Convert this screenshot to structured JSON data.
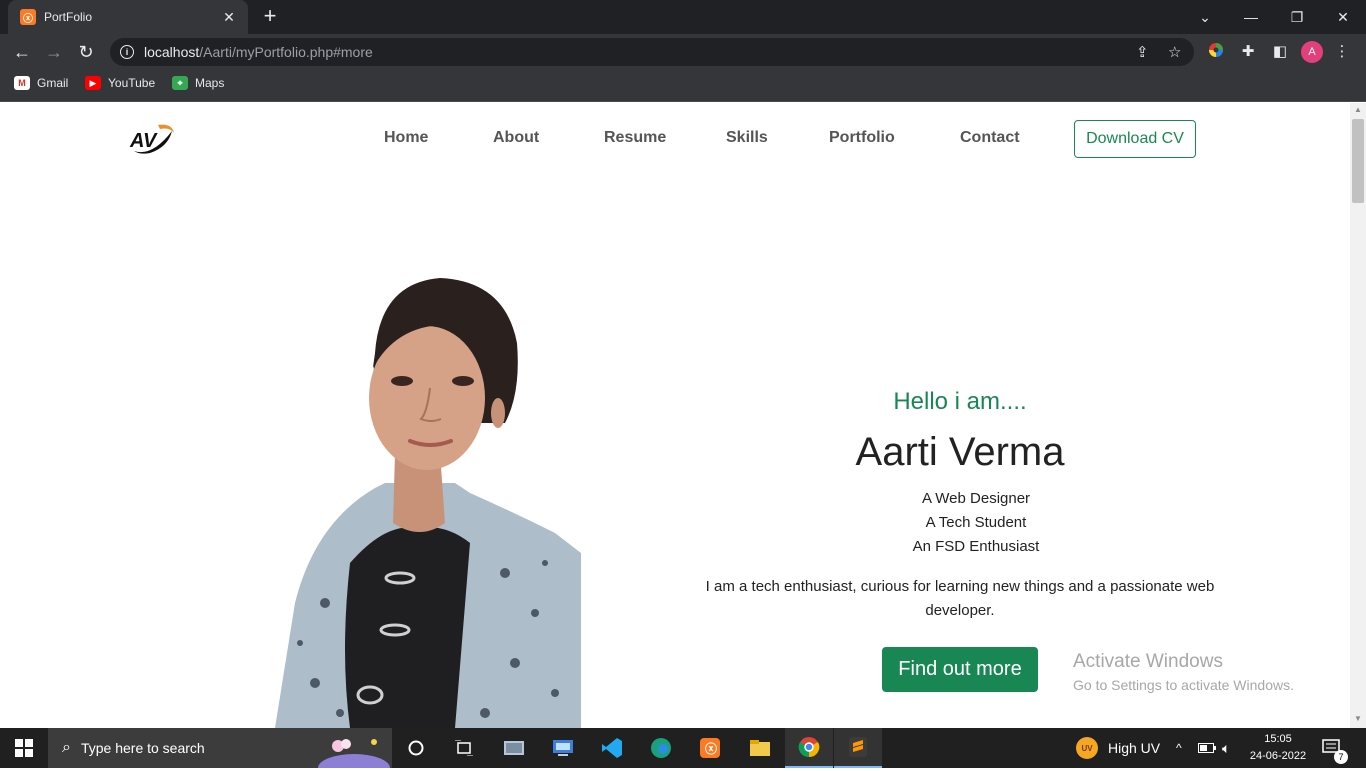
{
  "browser": {
    "tab_title": "PortFolio",
    "tab_favicon": "xampp-icon",
    "url_host": "localhost",
    "url_path": "/Aarti/myPortfolio.php#more",
    "bookmarks": [
      {
        "label": "Gmail",
        "icon": "gmail-icon"
      },
      {
        "label": "YouTube",
        "icon": "youtube-icon"
      },
      {
        "label": "Maps",
        "icon": "maps-icon"
      }
    ],
    "profile_initial": "A"
  },
  "nav": {
    "logo_text": "AV",
    "links": [
      "Home",
      "About",
      "Resume",
      "Skills",
      "Portfolio",
      "Contact"
    ],
    "cta": "Download CV"
  },
  "hero": {
    "greeting": "Hello i am....",
    "name": "Aarti Verma",
    "roles": [
      "A Web Designer",
      "A Tech Student",
      "An FSD Enthusiast"
    ],
    "description": "I am a tech enthusiast, curious for learning new things and a passionate web developer.",
    "button": "Find out more"
  },
  "watermark": {
    "title": "Activate Windows",
    "subtitle": "Go to Settings to activate Windows."
  },
  "taskbar": {
    "search_placeholder": "Type here to search",
    "weather": "High UV",
    "weather_badge": "UV",
    "time": "15:05",
    "date": "24-06-2022",
    "notifications": "7"
  },
  "colors": {
    "accent": "#198754",
    "chrome_dark": "#202124",
    "chrome_toolbar": "#35363a"
  }
}
